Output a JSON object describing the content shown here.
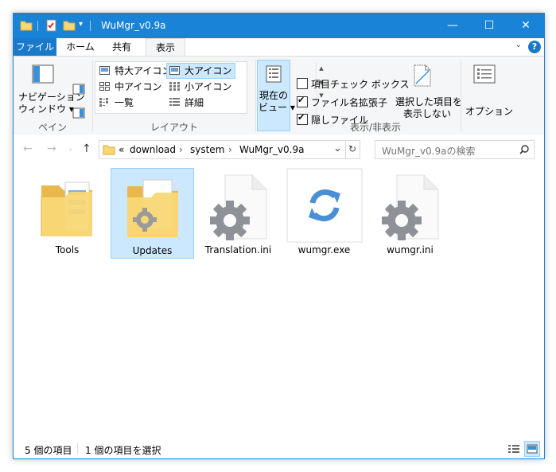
{
  "window": {
    "title": "WuMgr_v0.9a",
    "controls": {
      "minimize": "—",
      "maximize": "☐",
      "close": "✕"
    },
    "accent": "#1883d7"
  },
  "tabs": {
    "file": "ファイル",
    "home": "ホーム",
    "share": "共有",
    "view": "表示",
    "help": "?"
  },
  "ribbon": {
    "pane": {
      "nav_pane_line1": "ナビゲーション",
      "nav_pane_line2": "ウィンドウ ▾",
      "group_label": "ペイン"
    },
    "layout": {
      "items": [
        "特大アイコン",
        "大アイコン",
        "中アイコン",
        "小アイコン",
        "一覧",
        "詳細"
      ],
      "selected": "大アイコン",
      "group_label": "レイアウト"
    },
    "current_view": {
      "line1": "現在の",
      "line2": "ビュー ▾"
    },
    "show_hide": {
      "item_checkboxes": "項目チェック ボックス",
      "file_extensions": "ファイル名拡張子",
      "hidden_files": "隠しファイル",
      "hide_selected_line1": "選択した項目を",
      "hide_selected_line2": "表示しない",
      "group_label": "表示/非表示"
    },
    "options": {
      "label": "オプション"
    }
  },
  "address": {
    "overflow": "«",
    "crumbs": [
      "download",
      "system",
      "WuMgr_v0.9a"
    ],
    "separator": "›",
    "search_placeholder": "WuMgr_v0.9aの検索"
  },
  "files": [
    {
      "name": "Tools",
      "type": "folder"
    },
    {
      "name": "Updates",
      "type": "folder-gear",
      "selected": true
    },
    {
      "name": "Translation.ini",
      "type": "ini"
    },
    {
      "name": "wumgr.exe",
      "type": "exe"
    },
    {
      "name": "wumgr.ini",
      "type": "ini"
    }
  ],
  "status": {
    "count": "5 個の項目",
    "selection": "1 個の項目を選択"
  }
}
